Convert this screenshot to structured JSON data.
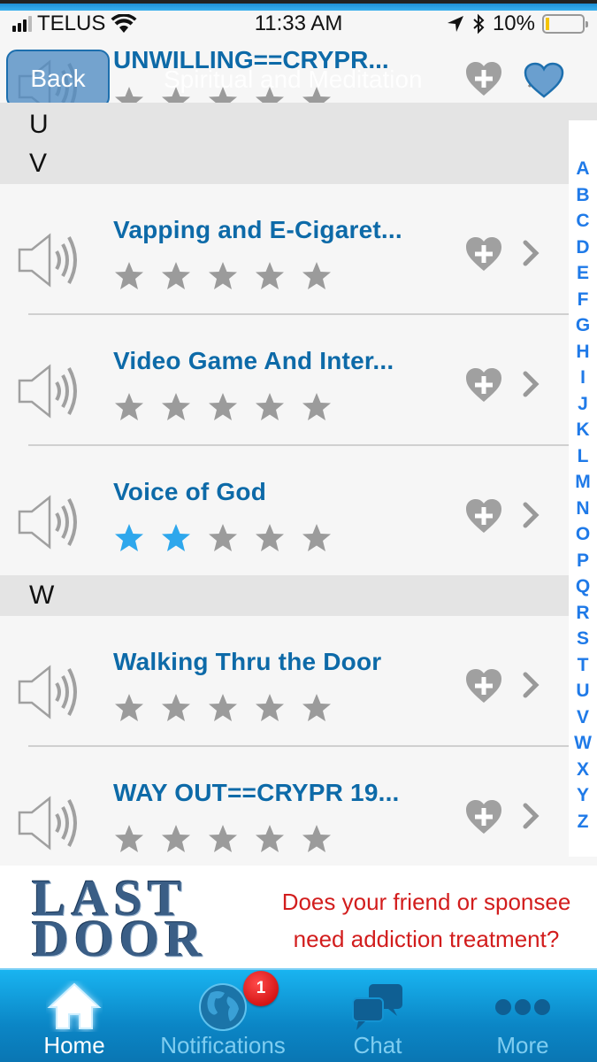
{
  "status_bar": {
    "carrier": "TELUS",
    "time": "11:33 AM",
    "battery_percent": "10%",
    "battery_level": 0.1
  },
  "nav": {
    "back_label": "Back",
    "title": "Spiritual and Meditation"
  },
  "partial_row": {
    "title": "UNWILLING==CRYPR...",
    "rating": 0
  },
  "sections": [
    {
      "letter": "U"
    },
    {
      "letter": "V"
    },
    {
      "letter": "W"
    }
  ],
  "rows": [
    {
      "title": "Vapping and E-Cigaret...",
      "rating": 0
    },
    {
      "title": "Video Game And Inter...",
      "rating": 0
    },
    {
      "title": "Voice of God",
      "rating": 2
    },
    {
      "title": "Walking Thru the Door",
      "rating": 0
    },
    {
      "title": "WAY OUT==CRYPR 19...",
      "rating": 0
    }
  ],
  "index_letters": [
    "A",
    "B",
    "C",
    "D",
    "E",
    "F",
    "G",
    "H",
    "I",
    "J",
    "K",
    "L",
    "M",
    "N",
    "O",
    "P",
    "Q",
    "R",
    "S",
    "T",
    "U",
    "V",
    "W",
    "X",
    "Y",
    "Z"
  ],
  "banner": {
    "logo_line1": "LAST",
    "logo_line2": "DOOR",
    "text_line1": "Does your friend or sponsee",
    "text_line2": "need addiction treatment?"
  },
  "tabs": [
    {
      "label": "Home",
      "icon": "home-icon",
      "active": true
    },
    {
      "label": "Notifications",
      "icon": "globe-icon",
      "active": false,
      "badge": "1"
    },
    {
      "label": "Chat",
      "icon": "chat-icon",
      "active": false
    },
    {
      "label": "More",
      "icon": "more-icon",
      "active": false
    }
  ],
  "colors": {
    "title_blue": "#0d6aa8",
    "index_blue": "#1f7ae8",
    "star_active": "#2ea7ec",
    "star_inactive": "#9b9b9b",
    "tab_bar": "#0b86c6",
    "ad_red": "#d21d1d",
    "badge_red": "#d00000"
  }
}
